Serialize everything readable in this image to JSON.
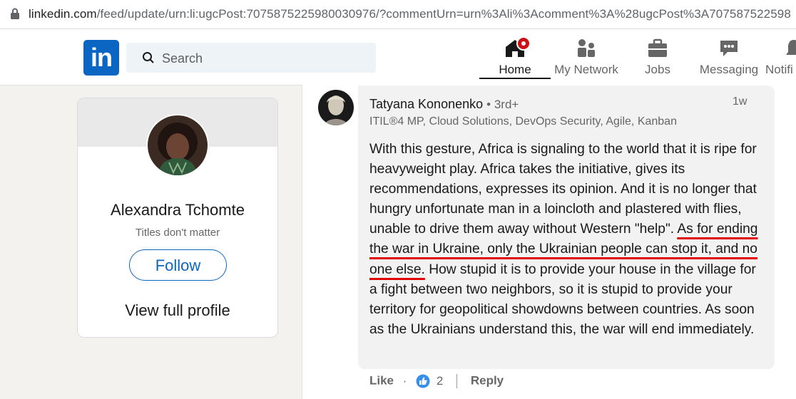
{
  "browser": {
    "url_host": "linkedin.com",
    "url_rest": "/feed/update/urn:li:ugcPost:7075875225980030976/?commentUrn=urn%3Ali%3Acomment%3A%28ugcPost%3A707587522598"
  },
  "nav": {
    "search_placeholder": "Search",
    "items": [
      {
        "label": "Home",
        "icon": "home-icon",
        "active": true
      },
      {
        "label": "My Network",
        "icon": "network-icon"
      },
      {
        "label": "Jobs",
        "icon": "briefcase-icon"
      },
      {
        "label": "Messaging",
        "icon": "messaging-icon"
      },
      {
        "label": "Notifi",
        "icon": "bell-icon"
      }
    ],
    "brand_color": "#0a66c2"
  },
  "profile_card": {
    "name": "Alexandra Tchomte",
    "headline": "Titles don't matter",
    "follow_label": "Follow",
    "view_profile_label": "View full profile"
  },
  "comment": {
    "author": "Tatyana Kononenko",
    "degree": "• 3rd+",
    "time": "1w",
    "headline": "ITIL®4 MP, Cloud Solutions, DevOps Security, Agile, Kanban",
    "body_before": "With this gesture, Africa is signaling to the world that it is ripe for heavyweight play. Africa takes the initiative, gives its recommendations, expresses its opinion. And it is no longer that hungry unfortunate man in a loincloth and plastered with flies, unable to drive them away without Western \"help\". ",
    "body_highlight": "As for ending the war in Ukraine, only the Ukrainian people can stop it, and no one else.",
    "body_after": " How stupid it is to provide your house in the village for a fight between two neighbors, so it is stupid to provide your territory for geopolitical showdowns between countries. As soon as the Ukrainians understand this, the war will end immediately.",
    "highlight_color": "#e00000",
    "actions": {
      "like_label": "Like",
      "dot": "·",
      "reaction_count": "2",
      "reply_label": "Reply"
    }
  }
}
